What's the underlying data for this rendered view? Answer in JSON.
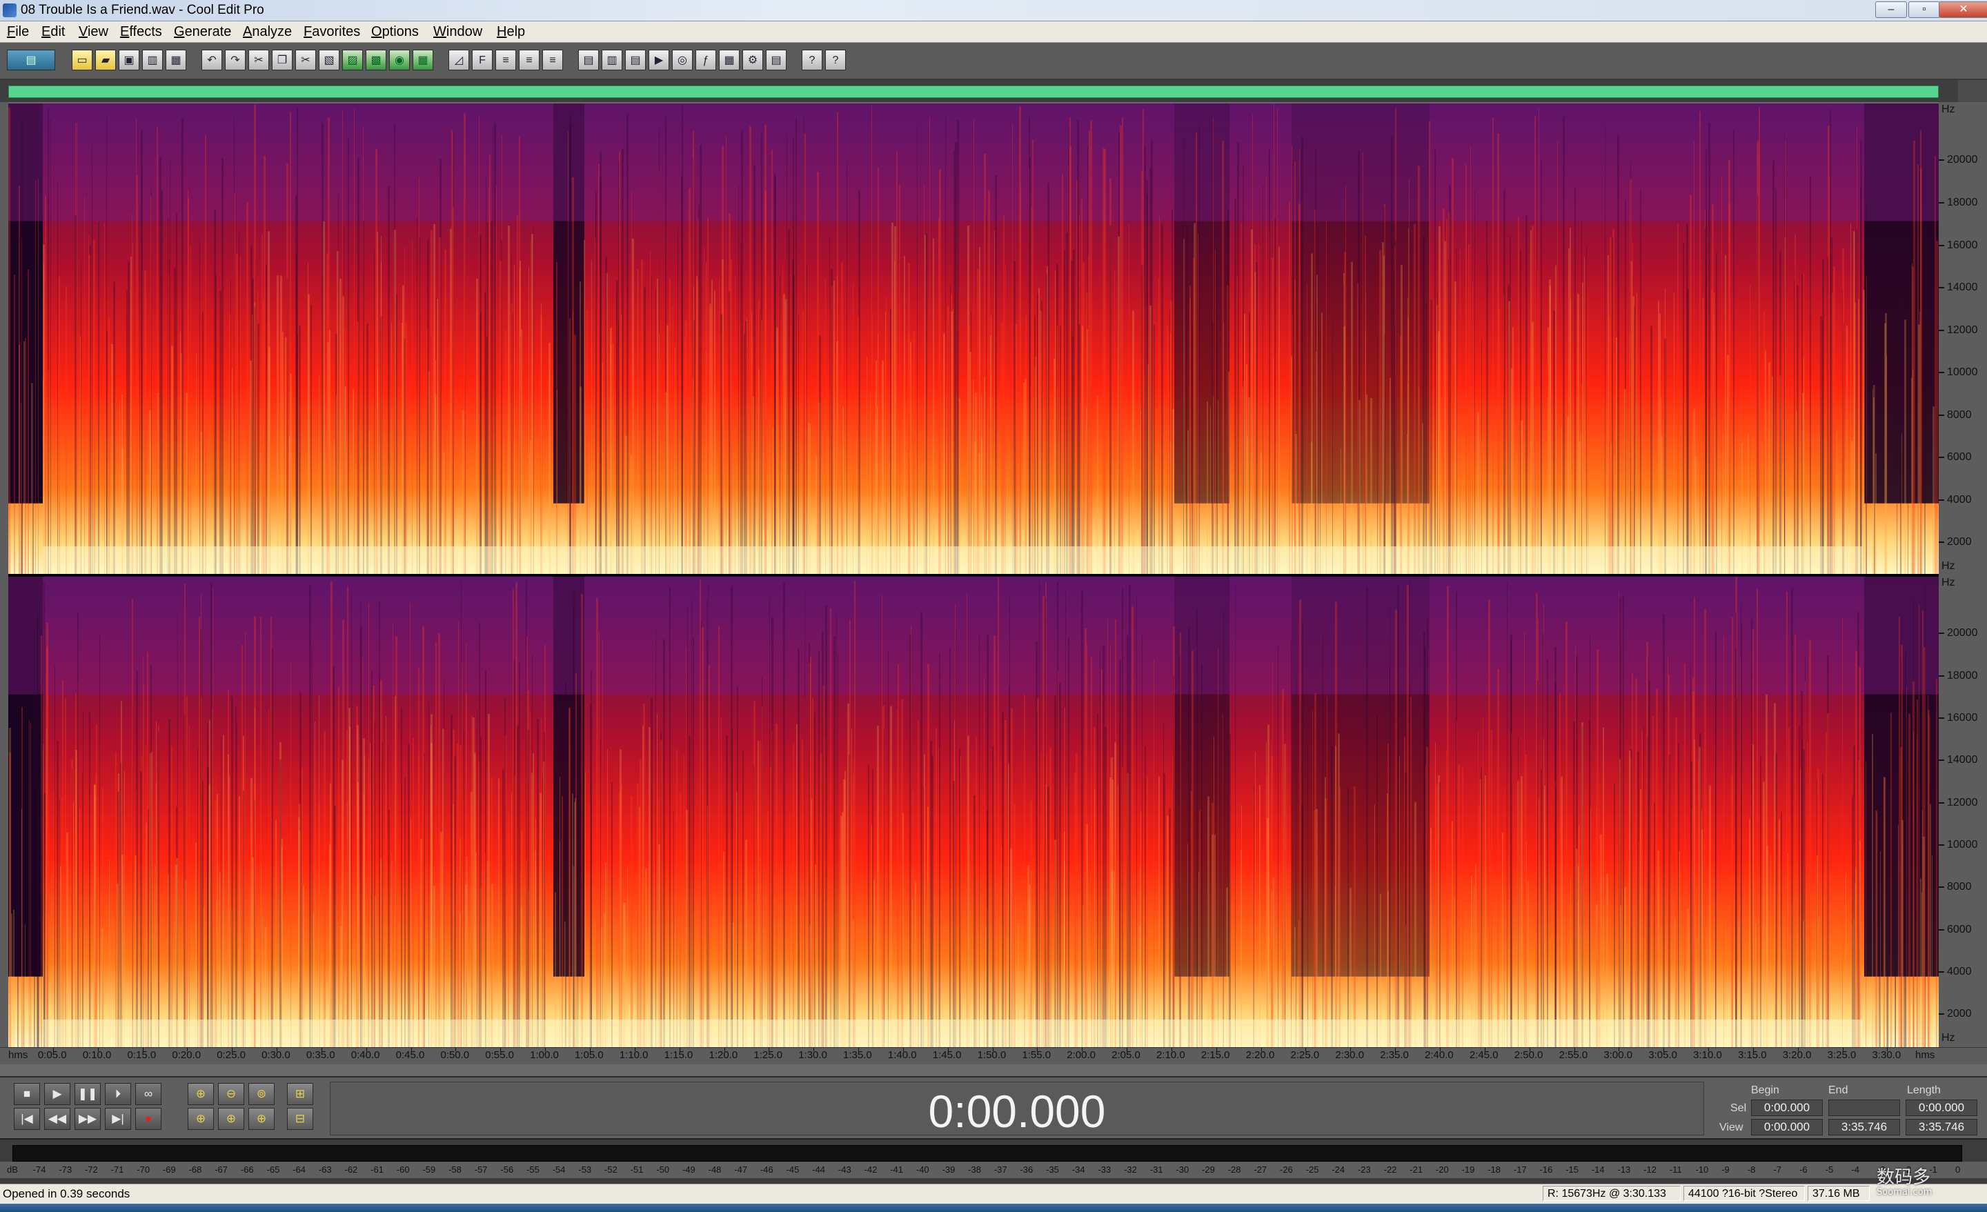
{
  "window": {
    "title": "08 Trouble Is a Friend.wav - Cool Edit Pro",
    "minimize": "–",
    "maximize": "▫",
    "close": "✕"
  },
  "menu": [
    "File",
    "Edit",
    "View",
    "Effects",
    "Generate",
    "Analyze",
    "Favorites",
    "Options",
    "Window",
    "Help"
  ],
  "toolbar": {
    "icons": [
      "multitrack-toggle-icon",
      "new-file-icon",
      "open-file-icon",
      "save-icon",
      "save-as-icon",
      "close-file-icon",
      "undo-icon",
      "redo-icon",
      "repeat-last-icon",
      "copy-icon",
      "cut-icon",
      "paste-icon",
      "paste-new-icon",
      "mix-paste-icon",
      "insert-cd-icon",
      "batch-icon",
      "waveform-view-icon",
      "spectral-view-icon",
      "snap-ruler-icon",
      "snap-cue-icon",
      "snap-zero-icon",
      "info-icon",
      "cue-list-icon",
      "play-list-icon",
      "frequency-analysis-icon",
      "phase-icon",
      "statistics-icon",
      "levels-icon",
      "settings-icon",
      "scripts-icon",
      "help-icon",
      "whats-this-icon"
    ]
  },
  "spectrogram": {
    "frequency_unit": "Hz",
    "frequency_labels": [
      "20000",
      "18000",
      "16000",
      "14000",
      "12000",
      "10000",
      "8000",
      "6000",
      "4000",
      "2000"
    ],
    "channels": [
      "left",
      "right"
    ],
    "colors": {
      "hot": "#fff6c0",
      "mid": "#ff2a10",
      "cool": "#7a1a7e",
      "cold": "#1a0422"
    }
  },
  "time_axis": {
    "start_label": "hms",
    "end_label": "hms",
    "labels": [
      "0:05.0",
      "0:10.0",
      "0:15.0",
      "0:20.0",
      "0:25.0",
      "0:30.0",
      "0:35.0",
      "0:40.0",
      "0:45.0",
      "0:50.0",
      "0:55.0",
      "1:00.0",
      "1:05.0",
      "1:10.0",
      "1:15.0",
      "1:20.0",
      "1:25.0",
      "1:30.0",
      "1:35.0",
      "1:40.0",
      "1:45.0",
      "1:50.0",
      "1:55.0",
      "2:00.0",
      "2:05.0",
      "2:10.0",
      "2:15.0",
      "2:20.0",
      "2:25.0",
      "2:30.0",
      "2:35.0",
      "2:40.0",
      "2:45.0",
      "2:50.0",
      "2:55.0",
      "3:00.0",
      "3:05.0",
      "3:10.0",
      "3:15.0",
      "3:20.0",
      "3:25.0",
      "3:30.0"
    ]
  },
  "transport": {
    "time_display": "0:00.000",
    "row1": [
      "■",
      "▶",
      "❚❚",
      "⏵",
      "∞"
    ],
    "row2": [
      "|◀",
      "◀◀",
      "▶▶",
      "▶|",
      "●"
    ],
    "zoom_row1": [
      "⊕",
      "⊖",
      "⊚",
      "⊞"
    ],
    "zoom_row2": [
      "⊕",
      "⊕",
      "⊕",
      "⊟"
    ]
  },
  "selection": {
    "headers": {
      "begin": "Begin",
      "end": "End",
      "length": "Length"
    },
    "sel": {
      "label": "Sel",
      "begin": "0:00.000",
      "end": "",
      "length": "0:00.000"
    },
    "view": {
      "label": "View",
      "begin": "0:00.000",
      "end": "3:35.746",
      "length": "3:35.746"
    }
  },
  "level_meter": {
    "labels": [
      "dB",
      "-74",
      "-73",
      "-72",
      "-71",
      "-70",
      "-69",
      "-68",
      "-67",
      "-66",
      "-65",
      "-64",
      "-63",
      "-62",
      "-61",
      "-60",
      "-59",
      "-58",
      "-57",
      "-56",
      "-55",
      "-54",
      "-53",
      "-52",
      "-51",
      "-50",
      "-49",
      "-48",
      "-47",
      "-46",
      "-45",
      "-44",
      "-43",
      "-42",
      "-41",
      "-40",
      "-39",
      "-38",
      "-37",
      "-36",
      "-35",
      "-34",
      "-33",
      "-32",
      "-31",
      "-30",
      "-29",
      "-28",
      "-27",
      "-26",
      "-25",
      "-24",
      "-23",
      "-22",
      "-21",
      "-20",
      "-19",
      "-18",
      "-17",
      "-16",
      "-15",
      "-14",
      "-13",
      "-12",
      "-11",
      "-10",
      "-9",
      "-8",
      "-7",
      "-6",
      "-5",
      "-4",
      "-3",
      "-2",
      "-1",
      "0"
    ]
  },
  "status": {
    "message": "Opened in 0.39 seconds",
    "cursor": "R: 15673Hz @    3:30.133",
    "format": "44100 ?16-bit ?Stereo",
    "size": "37.16 MB"
  },
  "watermark": {
    "main": "数码多",
    "sub": "Soomal.com"
  }
}
